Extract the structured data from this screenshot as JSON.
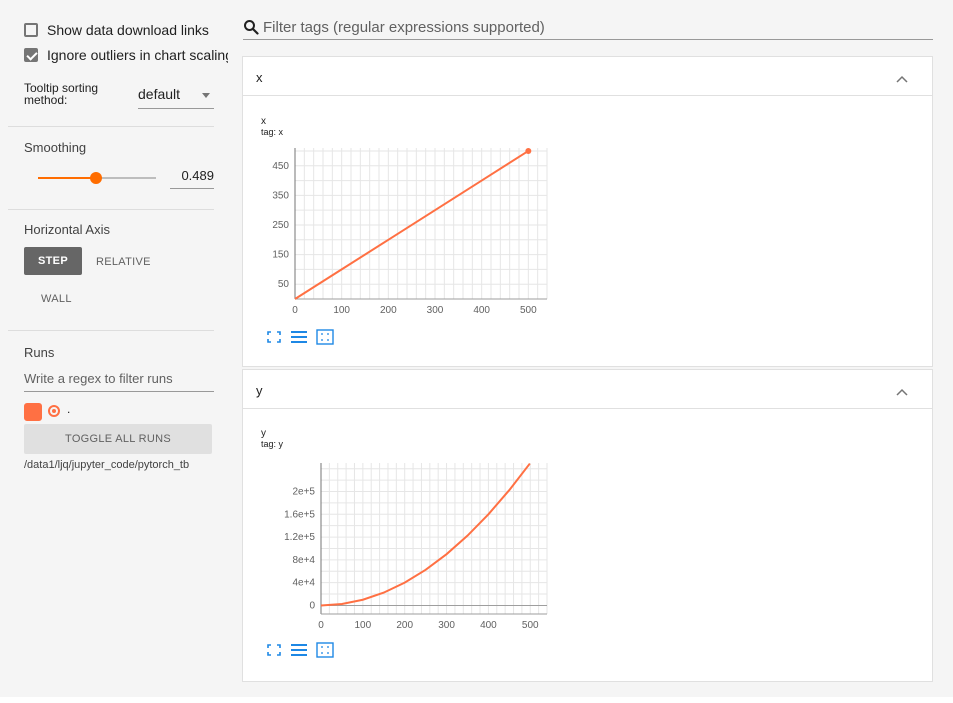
{
  "sidebar": {
    "show_download_links": "Show data download links",
    "ignore_outliers": "Ignore outliers in chart scaling",
    "tooltip_sorting_label": "Tooltip sorting method:",
    "tooltip_sorting_value": "default",
    "smoothing_label": "Smoothing",
    "smoothing_value": "0.489",
    "smoothing_fraction": 0.489,
    "horizontal_axis_label": "Horizontal Axis",
    "axis_buttons": [
      "STEP",
      "RELATIVE",
      "WALL"
    ],
    "axis_selected": "STEP",
    "runs_label": "Runs",
    "runs_filter_placeholder": "Write a regex to filter runs",
    "run_name": ".",
    "toggle_all_runs": "TOGGLE ALL RUNS",
    "run_path": "/data1/ljq/jupyter_code/pytorch_tb"
  },
  "search": {
    "placeholder": "Filter tags (regular expressions supported)"
  },
  "colors": {
    "series": "#ff7043",
    "accent": "#ff6d00",
    "step_button": "#666666"
  },
  "cards": [
    {
      "title": "x",
      "collapse_icon": "chevron-up-icon"
    },
    {
      "title": "y",
      "collapse_icon": "chevron-up-icon"
    }
  ],
  "chart_data": [
    {
      "type": "line",
      "title": "x",
      "subtitle": "tag: x",
      "x": [
        0,
        100,
        200,
        300,
        400,
        500
      ],
      "series": [
        {
          "values": [
            0,
            100,
            200,
            300,
            400,
            500
          ]
        }
      ],
      "xlim": [
        0,
        540
      ],
      "ylim": [
        0,
        510
      ],
      "xticks": [
        "0",
        "100",
        "200",
        "300",
        "400",
        "500"
      ],
      "yticks": [
        "50",
        "150",
        "250",
        "350",
        "450"
      ],
      "grid": true
    },
    {
      "type": "line",
      "title": "y",
      "subtitle": "tag: y",
      "x": [
        0,
        50,
        100,
        150,
        200,
        250,
        300,
        350,
        400,
        450,
        499
      ],
      "series": [
        {
          "values": [
            0,
            2500,
            10000,
            22500,
            40000,
            62500,
            90000,
            122500,
            160000,
            202500,
            249001
          ]
        }
      ],
      "xlim": [
        0,
        540
      ],
      "ylim": [
        -15000,
        250000
      ],
      "xticks": [
        "0",
        "100",
        "200",
        "300",
        "400",
        "500"
      ],
      "yticks": [
        "0",
        "4e+4",
        "8e+4",
        "1.2e+5",
        "1.6e+5",
        "2e+5"
      ],
      "grid": true
    }
  ]
}
